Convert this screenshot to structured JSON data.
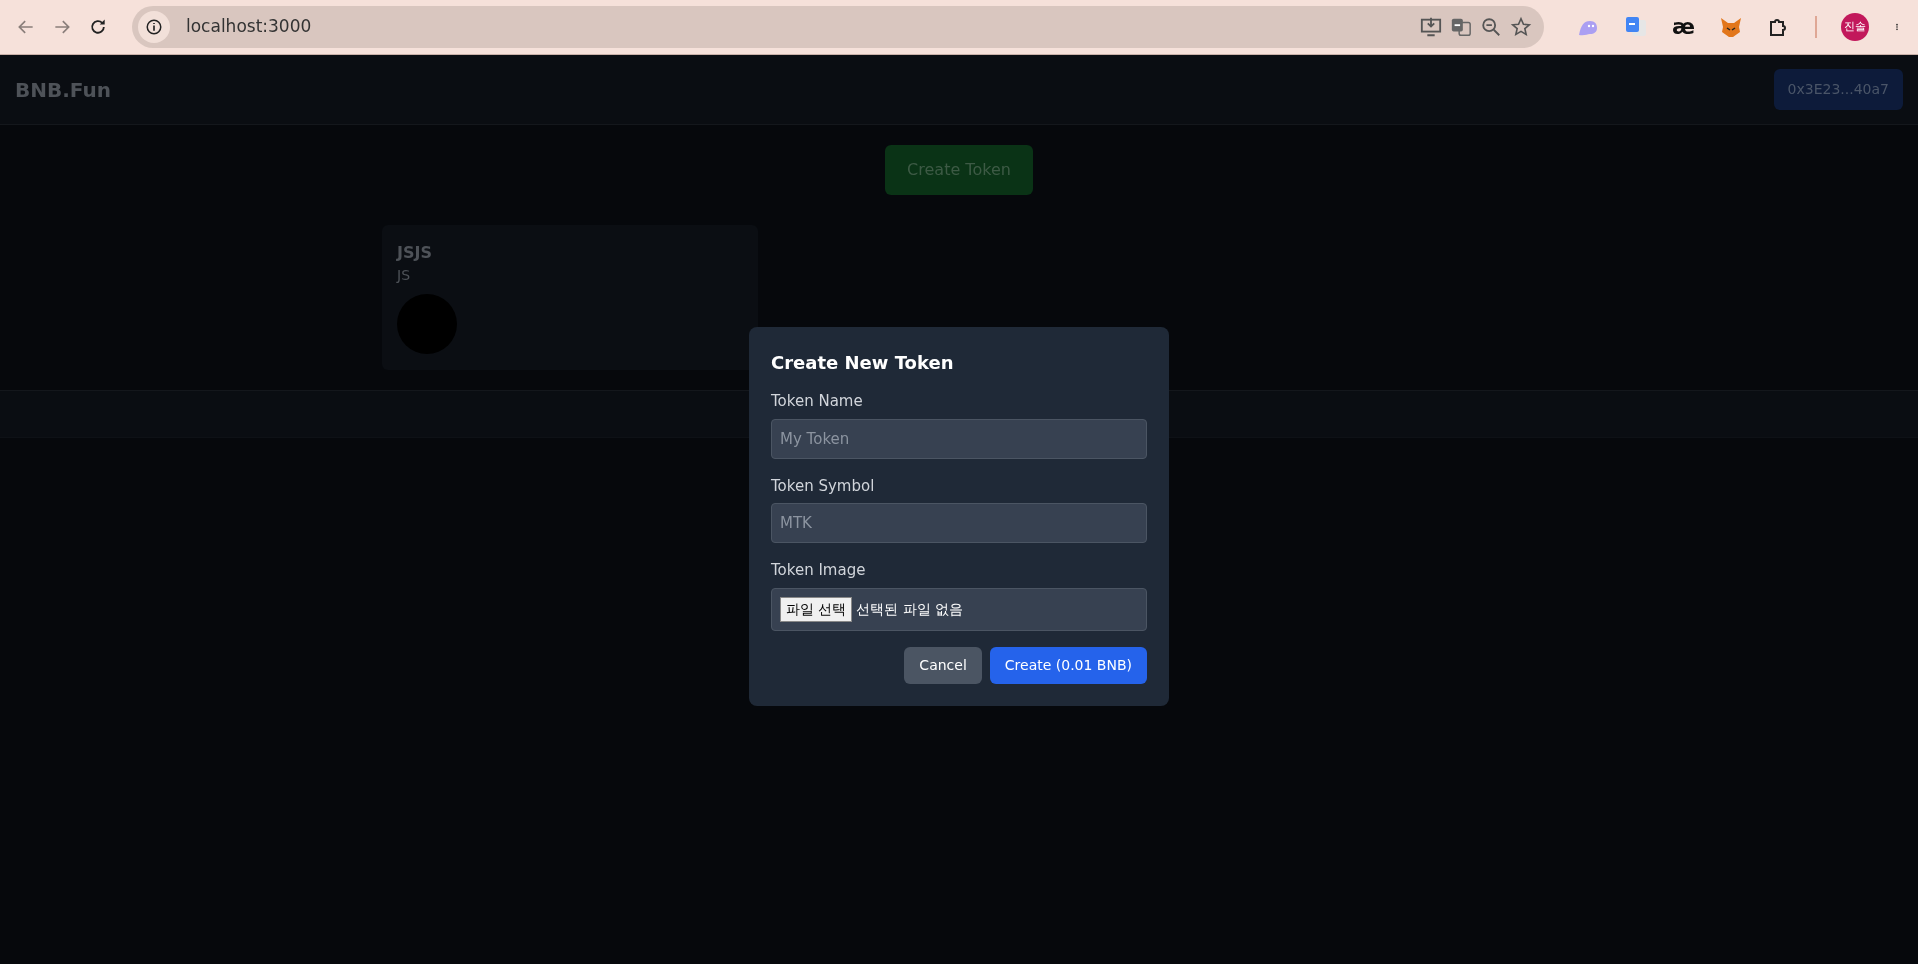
{
  "browser": {
    "url": "localhost:3000",
    "extension_text": "æ",
    "profile": "진솔"
  },
  "header": {
    "logo": "BNB.Fun",
    "wallet": "0x3E23...40a7"
  },
  "create_button": "Create Token",
  "tokens": [
    {
      "name": "JSJS",
      "symbol": "JS"
    }
  ],
  "modal": {
    "title": "Create New Token",
    "fields": [
      {
        "kind": "text",
        "label": "Token Name",
        "placeholder": "My Token"
      },
      {
        "kind": "text",
        "label": "Token Symbol",
        "placeholder": "MTK"
      },
      {
        "kind": "file",
        "label": "Token Image",
        "button": "파일 선택",
        "status": "선택된 파일 없음"
      }
    ],
    "buttons": [
      {
        "kind": "secondary",
        "label": "Cancel"
      },
      {
        "kind": "primary",
        "label": "Create (0.01 BNB)"
      }
    ]
  }
}
